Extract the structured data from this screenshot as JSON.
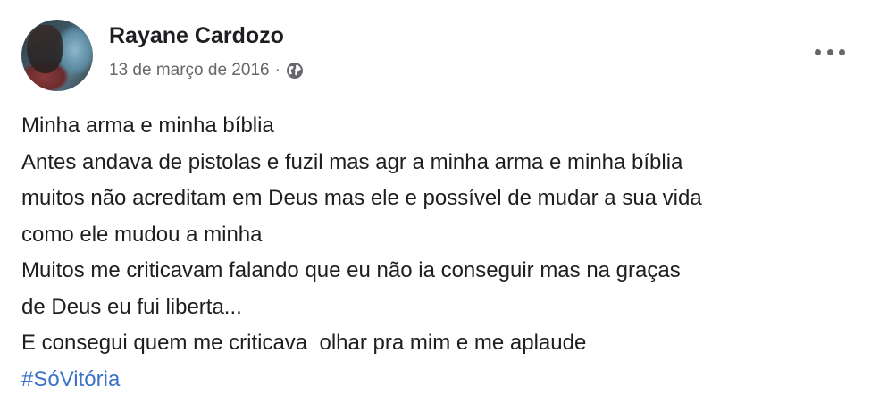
{
  "post": {
    "author": "Rayane Cardozo",
    "date": "13 de março de 2016",
    "separator": "·",
    "privacy_icon": "globe-icon",
    "menu_icon": "more-options-icon",
    "lines": [
      "Minha arma e minha bíblia",
      "Antes andava de pistolas e fuzil mas agr a minha arma e minha bíblia",
      "muitos não acreditam em Deus mas ele e possível de mudar a sua vida",
      "como ele mudou a minha",
      "Muitos me criticavam falando que eu não ia conseguir mas na graças",
      "de Deus eu fui liberta...",
      "E consegui quem me criticava  olhar pra mim e me aplaude"
    ],
    "hashtag": "#SóVitória"
  },
  "colors": {
    "name": "#1c1e21",
    "meta": "#65676b",
    "hashtag": "#3b72c6"
  }
}
